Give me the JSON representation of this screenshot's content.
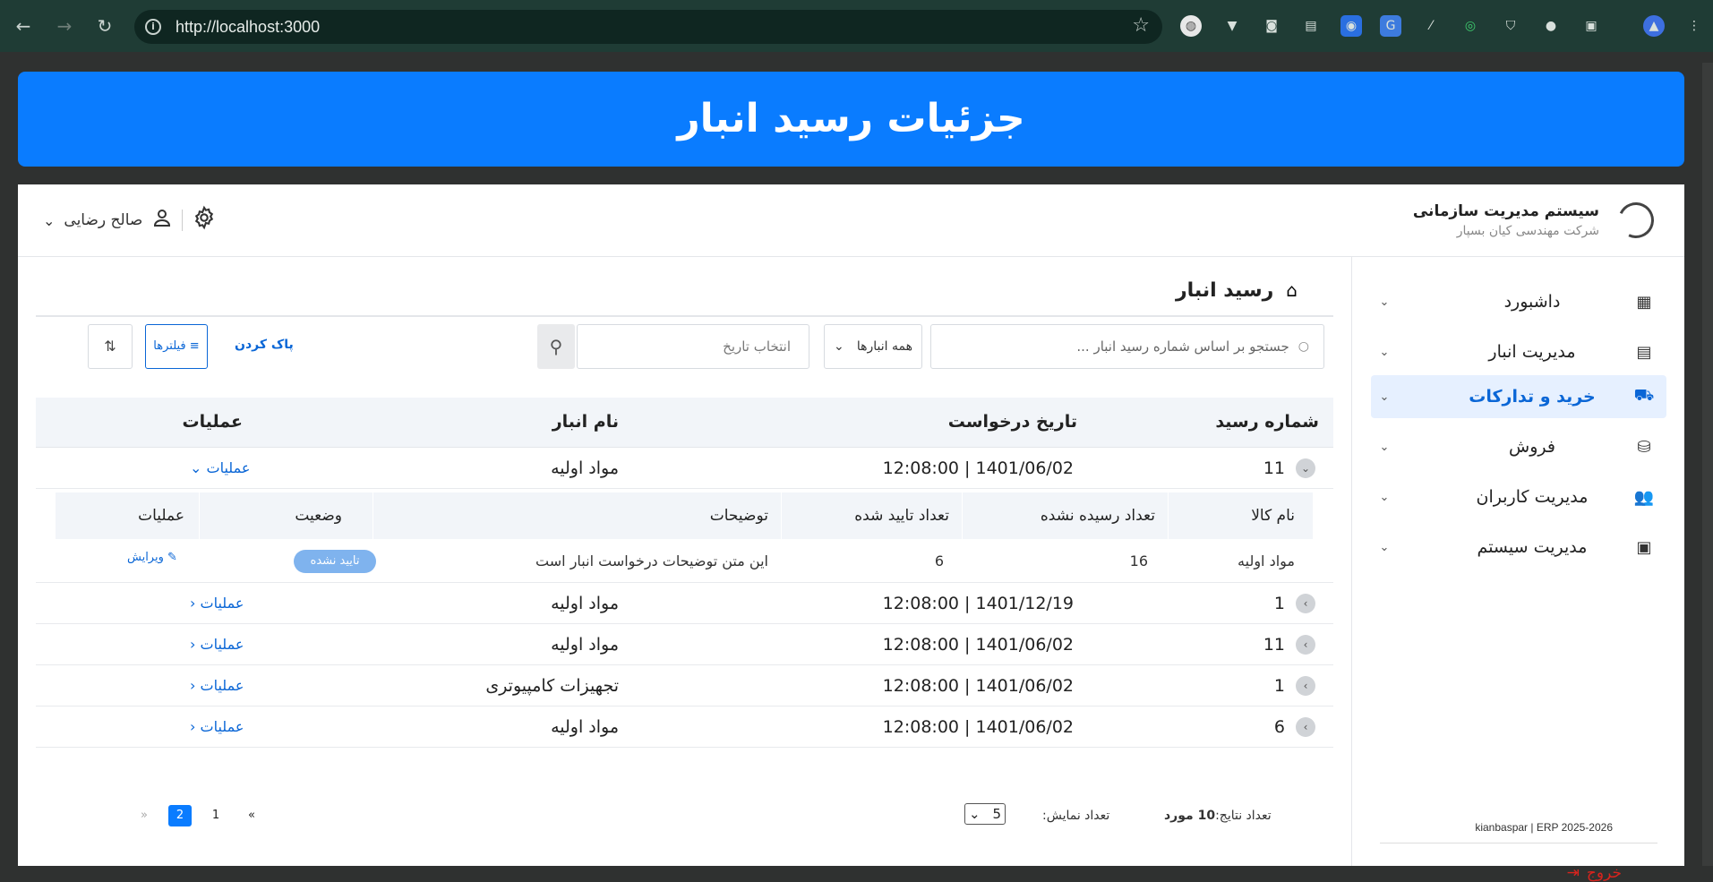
{
  "browser": {
    "url": "http://localhost:3000"
  },
  "banner": {
    "title": "جزئیات رسید انبار"
  },
  "brand": {
    "title": "سیستم مدیریت سازمانی",
    "subtitle": "شرکت مهندسی کیان بسپار"
  },
  "user": {
    "name": "صالح رضایی"
  },
  "sidebar": {
    "items": [
      {
        "label": "داشبورد",
        "icon": "dashboard-icon",
        "active": false
      },
      {
        "label": "مدیریت انبار",
        "icon": "warehouse-icon",
        "active": false
      },
      {
        "label": "خرید و تدارکات",
        "icon": "basket-icon",
        "active": true
      },
      {
        "label": "فروش",
        "icon": "coins-icon",
        "active": false
      },
      {
        "label": "مدیریت کاربران",
        "icon": "users-icon",
        "active": false
      },
      {
        "label": "مدیریت سیستم",
        "icon": "system-icon",
        "active": false
      }
    ],
    "copyright": "kianbaspar | ERP 2025-2026",
    "logout": "خروج"
  },
  "page": {
    "title": "رسید انبار"
  },
  "filters": {
    "search_placeholder": "جستجو بر اساس شماره رسید انبار ...",
    "warehouse_select": "همه انبارها",
    "date_placeholder": "انتخاب تاریخ",
    "clear_label": "پاک کردن",
    "filter_label": "فیلترها"
  },
  "table": {
    "headers": {
      "receipt_no": "شماره رسید",
      "request_date": "تاریخ درخواست",
      "warehouse": "نام انبار",
      "operations": "عملیات"
    },
    "rows": [
      {
        "receipt_no": "11",
        "date": "1401/06/02 | 12:08:00",
        "warehouse": "مواد اولیه",
        "ops": "عملیات",
        "expanded": true
      },
      {
        "receipt_no": "1",
        "date": "1401/12/19 | 12:08:00",
        "warehouse": "مواد اولیه",
        "ops": "عملیات",
        "expanded": false
      },
      {
        "receipt_no": "11",
        "date": "1401/06/02 | 12:08:00",
        "warehouse": "مواد اولیه",
        "ops": "عملیات",
        "expanded": false
      },
      {
        "receipt_no": "1",
        "date": "1401/06/02 | 12:08:00",
        "warehouse": "تجهیزات کامپیوتری",
        "ops": "عملیات",
        "expanded": false
      },
      {
        "receipt_no": "6",
        "date": "1401/06/02 | 12:08:00",
        "warehouse": "مواد اولیه",
        "ops": "عملیات",
        "expanded": false
      }
    ],
    "subtable": {
      "headers": {
        "item_name": "نام کالا",
        "not_received": "تعداد رسیده نشده",
        "approved": "تعداد تایید شده",
        "description": "توضیحات",
        "status": "وضعیت",
        "operations": "عملیات"
      },
      "row": {
        "item_name": "مواد اولیه",
        "not_received": "16",
        "approved": "6",
        "description": "این متن توضیحات درخواست انبار است",
        "status": "تایید نشده",
        "edit": "ویرایش"
      }
    }
  },
  "footer": {
    "total_label": "تعداد نتایج:",
    "total_value": "10 مورد",
    "show_label": "تعداد نمایش:",
    "page_size": "5",
    "pages": [
      "1",
      "2"
    ],
    "current_page": "2",
    "first": "«",
    "last": "»"
  },
  "colors": {
    "primary": "#0a7cff",
    "link": "#0a66d6",
    "danger": "#d9231d",
    "badge": "#7fb3ee"
  }
}
